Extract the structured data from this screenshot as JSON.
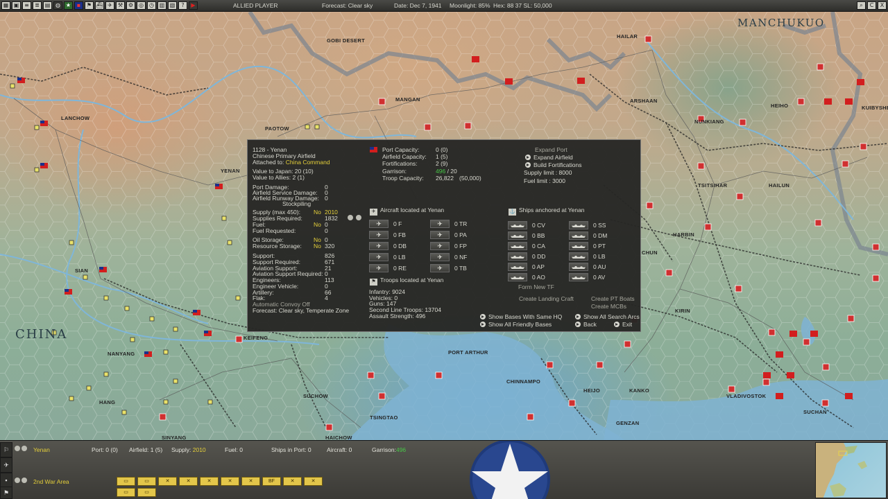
{
  "topbar": {
    "side": "ALLIED PLAYER",
    "forecast": "Forecast: Clear sky",
    "date": "Date: Dec 7, 1941",
    "moonlight": "Moonlight: 85%",
    "hex": "Hex: 88  37  SL: 50,000",
    "icons": [
      "grid-icon",
      "save-icon",
      "list-icon",
      "list-icon",
      "report-icon",
      "globe-icon",
      "star-icon",
      "flag-icon",
      "group-icon",
      "ship-icon",
      "plane-icon",
      "tool-icon",
      "gear-icon",
      "globe-icon",
      "clock-icon",
      "chart-icon",
      "map-icon",
      "help-icon",
      "play-icon"
    ],
    "right_icons": [
      "zoom-icon",
      "c-icon",
      "close-icon"
    ],
    "right_labels": [
      "⌕",
      "C",
      "X"
    ]
  },
  "map": {
    "labels": {
      "manchukuo": "MANCHUKUO",
      "china": "CHINA",
      "gobi": "GOBI DESERT",
      "hailar": "HAILAR",
      "mangan": "MANGAN",
      "arshaan": "ARSHAAN",
      "lanchow": "LANCHOW",
      "paotow": "PAOTOW",
      "yenan": "YENAN",
      "heiho": "HEIHO",
      "kuibyshev": "KUIBYSHEV",
      "nunkiang": "NUNKIANG",
      "tsitsihar": "TSITSIHAR",
      "hailun": "HAILUN",
      "harbin": "HARBIN",
      "kirin": "KIRIN",
      "sian": "SIAN",
      "keifeng": "KEIFENG",
      "nanyang": "NANYANG",
      "port_arthur": "PORT ARTHUR",
      "chinnampo": "CHINNAMPO",
      "suchow": "SUCHOW",
      "tsingtao": "TSINGTAO",
      "haichow": "HAICHOW",
      "sinyang": "SINYANG",
      "hang": "HANG",
      "heijo": "HEIJO",
      "kanko": "KANKO",
      "genzan": "GENZAN",
      "vladivostok": "VLADIVOSTOK",
      "suchan": "SUCHAN",
      "chun": "CHUN"
    }
  },
  "panel": {
    "base_id": "1128 - Yenan",
    "base_type": "Chinese Primary Airfield",
    "attached_label": "Attached to:",
    "attached_value": "China Command",
    "value_japan": "Value to Japan: 20 (10)",
    "value_allies": "Value to Allies: 2 (1)",
    "damage": [
      {
        "label": "Port Damage:",
        "value": "0"
      },
      {
        "label": "Airfield Service Damage:",
        "value": "0"
      },
      {
        "label": "Airfield Runway Damage:",
        "value": "0"
      }
    ],
    "stockpiling": "Stockpiling",
    "supply": {
      "label": "Supply (max 450):",
      "flag": "No",
      "value": "2010"
    },
    "supplies_required": {
      "label": "Supplies Required:",
      "value": "1832"
    },
    "fuel": {
      "label": "Fuel:",
      "flag": "No",
      "value": "0"
    },
    "fuel_requested": {
      "label": "Fuel Requested:",
      "value": "0"
    },
    "oil_storage": {
      "label": "Oil Storage:",
      "flag": "No",
      "value": "0"
    },
    "resource_storage": {
      "label": "Resource Storage:",
      "flag": "No",
      "value": "320"
    },
    "support": [
      {
        "label": "Support:",
        "value": "826"
      },
      {
        "label": "Support Required:",
        "value": "671"
      },
      {
        "label": "Aviation Support:",
        "value": "21"
      },
      {
        "label": "Aviation Support Required:",
        "value": "0"
      },
      {
        "label": "Engineers:",
        "value": "113"
      },
      {
        "label": "Engineer Vehicle:",
        "value": "0"
      },
      {
        "label": "Artillery:",
        "value": "66"
      },
      {
        "label": "Flak:",
        "value": "4"
      }
    ],
    "auto_convoy": "Automatic Convoy Off",
    "forecast": "Forecast: Clear sky, Temperate Zone",
    "capacity": [
      {
        "label": "Port Capacity:",
        "value": "0 (0)"
      },
      {
        "label": "Airfield Capacity:",
        "value": "1 (5)"
      },
      {
        "label": "Fortifications:",
        "value": "2 (9)"
      }
    ],
    "garrison": {
      "label": "Garrison:",
      "current": "496",
      "required": "/ 20"
    },
    "troop_capacity": {
      "label": "Troop Capacity:",
      "value": "26,822",
      "max": "(50,000)"
    },
    "actions": {
      "expand_port": "Expand Port",
      "expand_airfield": "Expand Airfield",
      "build_fortifications": "Build Fortifications",
      "supply_limit": "Supply limit : 8000",
      "fuel_limit": "Fuel limit : 3000"
    },
    "aircraft_header": "Aircraft located at Yenan",
    "aircraft": [
      {
        "count": "0",
        "type": "F"
      },
      {
        "count": "0",
        "type": "TR"
      },
      {
        "count": "0",
        "type": "FB"
      },
      {
        "count": "0",
        "type": "PA"
      },
      {
        "count": "0",
        "type": "DB"
      },
      {
        "count": "0",
        "type": "FP"
      },
      {
        "count": "0",
        "type": "LB"
      },
      {
        "count": "0",
        "type": "NF"
      },
      {
        "count": "0",
        "type": "RE"
      },
      {
        "count": "0",
        "type": "TB"
      }
    ],
    "ships_header": "Ships anchored at Yenan",
    "ships": [
      {
        "count": "0",
        "type": "CV"
      },
      {
        "count": "0",
        "type": "SS"
      },
      {
        "count": "0",
        "type": "BB"
      },
      {
        "count": "0",
        "type": "DM"
      },
      {
        "count": "0",
        "type": "CA"
      },
      {
        "count": "0",
        "type": "PT"
      },
      {
        "count": "0",
        "type": "DD"
      },
      {
        "count": "0",
        "type": "LB"
      },
      {
        "count": "0",
        "type": "AP"
      },
      {
        "count": "0",
        "type": "AU"
      },
      {
        "count": "0",
        "type": "AO"
      },
      {
        "count": "0",
        "type": "AV"
      }
    ],
    "troops_header": "Troops located at Yenan",
    "troops": [
      "Infantry: 9024",
      "Vehicles: 0",
      "Guns: 147",
      "Second Line Troops: 13704",
      "Assault Strength: 496"
    ],
    "form_new_tf": "Form New TF",
    "create_landing_craft": "Create Landing Craft",
    "create_pt_boats": "Create PT Boats",
    "create_mcbs": "Create MCBs",
    "show_bases_same_hq": "Show Bases With Same HQ",
    "show_all_friendly": "Show All Friendly Bases",
    "show_search_arcs": "Show All Search Arcs",
    "back": "Back",
    "exit": "Exit",
    "colors": {
      "highlight_yellow": "#e4cf3a",
      "highlight_green": "#47c847"
    }
  },
  "bottombar": {
    "location": "Yenan",
    "port": "Port: 0 (0)",
    "airfield": "Airfield: 1 (5)",
    "supply_label": "Supply:",
    "supply_value": "2010",
    "fuel": "Fuel: 0",
    "ships_in_port": "Ships in Port: 0",
    "aircraft": "Aircraft: 0",
    "garrison_label": "Garrison:",
    "garrison_value": "496",
    "area": "2nd War Area",
    "unit_counters": [
      "▭",
      "▭",
      "✕",
      "✕",
      "✕",
      "✕",
      "✕",
      "BF",
      "✕",
      "✕"
    ],
    "unit_counters_row2": [
      "▭",
      "▭"
    ]
  }
}
